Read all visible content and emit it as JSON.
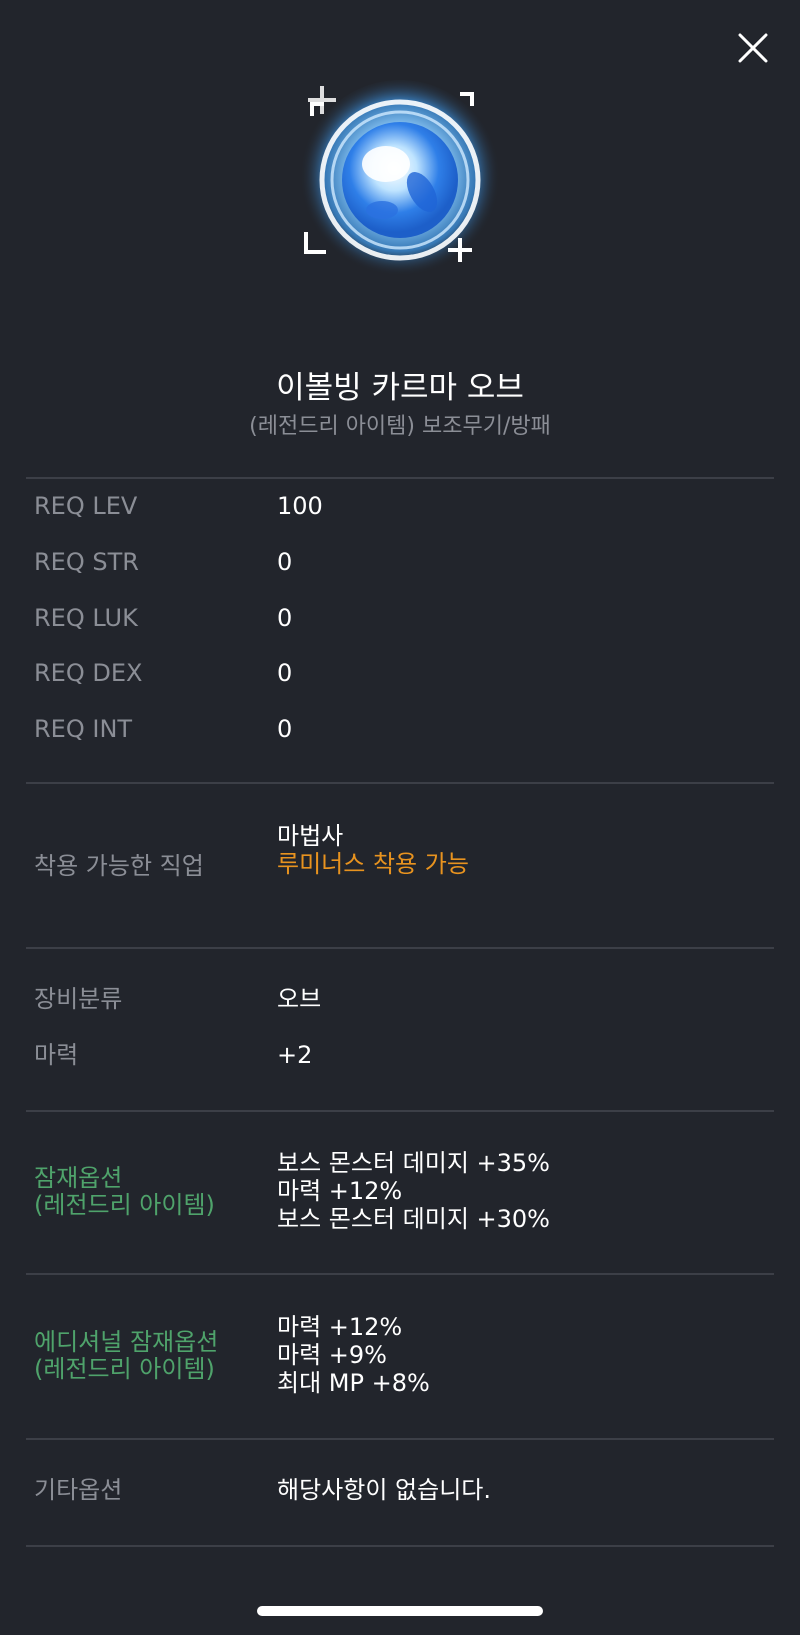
{
  "item": {
    "name": "이볼빙 카르마 오브",
    "subtitle": "(레전드리 아이템) 보조무기/방패",
    "image_icon": "orb-icon"
  },
  "requirements": [
    {
      "label": "REQ LEV",
      "value": "100"
    },
    {
      "label": "REQ STR",
      "value": "0"
    },
    {
      "label": "REQ LUK",
      "value": "0"
    },
    {
      "label": "REQ DEX",
      "value": "0"
    },
    {
      "label": "REQ INT",
      "value": "0"
    }
  ],
  "jobs": {
    "label": "착용 가능한 직업",
    "value": "마법사",
    "note": "루미너스 착용 가능"
  },
  "equipment": {
    "category_label": "장비분류",
    "category_value": "오브",
    "magic_label": "마력",
    "magic_value": "+2"
  },
  "potential": {
    "label_line1": "잠재옵션",
    "label_line2": "(레전드리 아이템)",
    "lines": [
      "보스 몬스터 데미지 +35%",
      "마력 +12%",
      "보스 몬스터 데미지 +30%"
    ]
  },
  "additional_potential": {
    "label_line1": "에디셔널 잠재옵션",
    "label_line2": "(레전드리 아이템)",
    "lines": [
      "마력 +12%",
      "마력 +9%",
      "최대 MP +8%"
    ]
  },
  "other": {
    "label": "기타옵션",
    "value": "해당사항이 없습니다."
  },
  "colors": {
    "background": "#22252c",
    "label_gray": "#8b8e96",
    "potential_green": "#4fa36b",
    "note_orange": "#e8931f"
  }
}
